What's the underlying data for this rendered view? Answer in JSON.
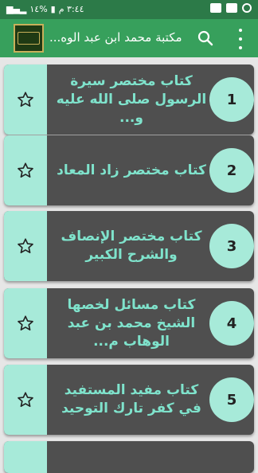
{
  "status_bar": {
    "time": "٣:٤٤ م",
    "battery": "%١٤"
  },
  "app_bar": {
    "title": "مكتبة محمد ابن عبد الوه...",
    "search_icon": "search-icon",
    "menu_icon": "more-vert-icon"
  },
  "colors": {
    "status_bar": "#2c7a48",
    "app_bar": "#37a05c",
    "card_bg": "#4f4f4f",
    "accent": "#a7ead9",
    "card_text": "#7fe3cc"
  },
  "books": [
    {
      "number": "1",
      "title": "كتاب مختصر سيرة الرسول صلى الله عليه و..."
    },
    {
      "number": "2",
      "title": "كتاب مختصر زاد المعاد"
    },
    {
      "number": "3",
      "title": "كتاب مختصر الإنصاف والشرح الكبير"
    },
    {
      "number": "4",
      "title": "كتاب مسائل لخصها الشيخ محمد بن عبد الوهاب م..."
    },
    {
      "number": "5",
      "title": "كتاب مفيد المستفيد في كفر تارك التوحيد"
    }
  ]
}
